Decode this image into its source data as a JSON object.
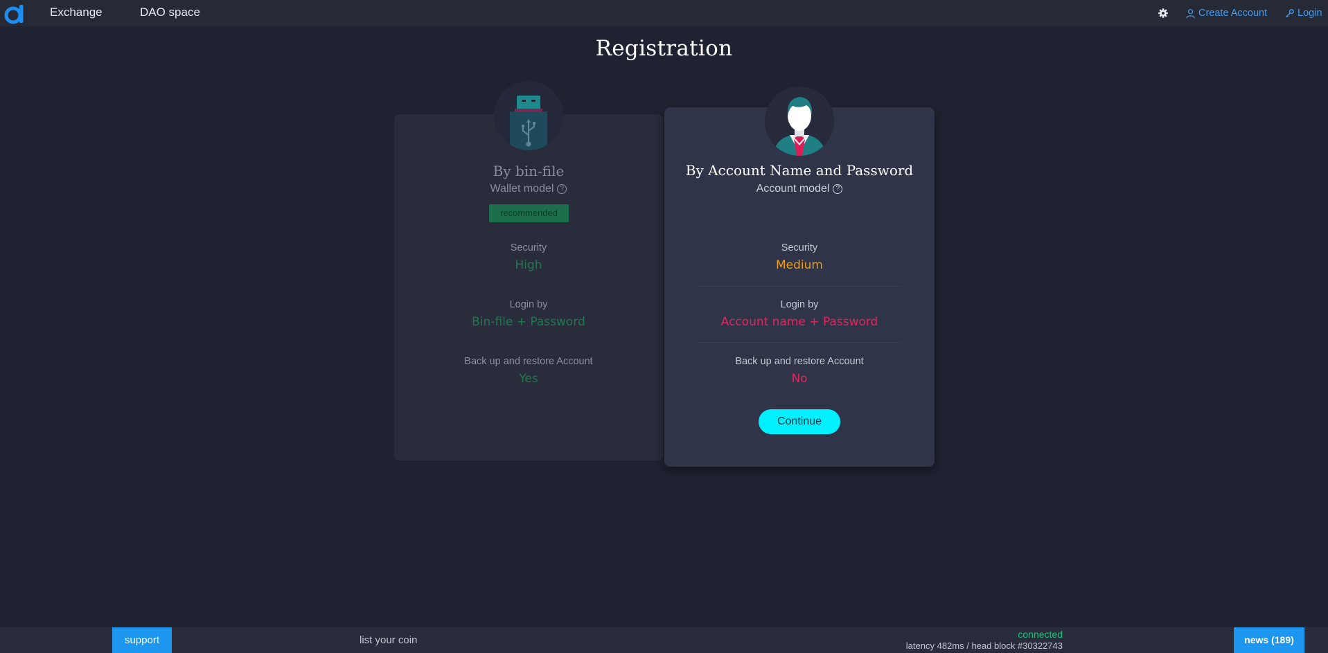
{
  "colors": {
    "background": "#1f2331",
    "topbar": "#262a37",
    "accent_blue": "#3f9cf1",
    "security_high": "#1f7a4e",
    "security_medium": "#f29b0c",
    "negative": "#e5255b",
    "continue_button": "#00f0ff",
    "footer_button": "#1d96ef",
    "connected": "#1bc47d"
  },
  "header": {
    "logo_icon": "brand-logo-icon",
    "nav": [
      {
        "label": "Exchange"
      },
      {
        "label": "DAO space"
      }
    ],
    "settings_icon": "gear-icon",
    "create_account": "Create Account",
    "login": "Login"
  },
  "page": {
    "title": "Registration"
  },
  "cards": {
    "bin": {
      "icon": "usb-key-icon",
      "heading": "By bin-file",
      "subtitle": "Wallet model",
      "badge": "recommended",
      "security_label": "Security",
      "security_value": "High",
      "login_label": "Login by",
      "login_value": "Bin-file + Password",
      "backup_label": "Back up and restore Account",
      "backup_value": "Yes"
    },
    "account": {
      "icon": "user-avatar-icon",
      "heading": "By Account Name and Password",
      "subtitle": "Account model",
      "security_label": "Security",
      "security_value": "Medium",
      "login_label": "Login by",
      "login_value": "Account name + Password",
      "backup_label": "Back up and restore Account",
      "backup_value": "No",
      "continue": "Continue"
    }
  },
  "footer": {
    "support": "support",
    "list_coin": "list your coin",
    "status": "connected",
    "latency": "latency 482ms / head block #30322743",
    "news": "news (189)"
  }
}
